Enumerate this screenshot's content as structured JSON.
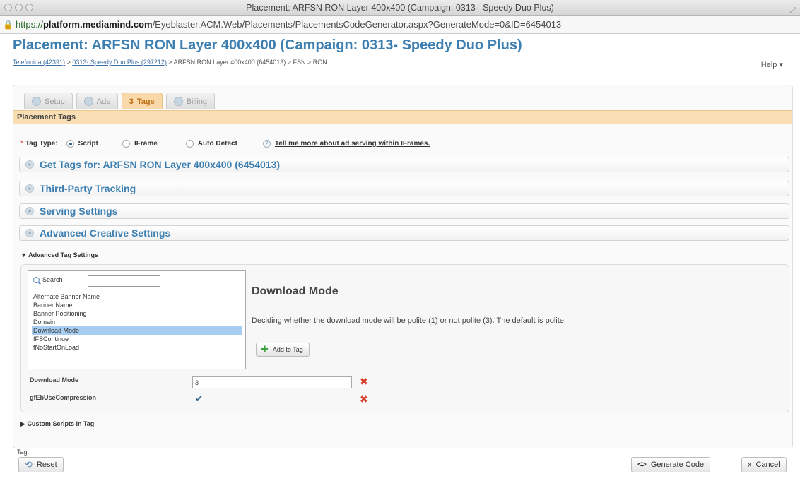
{
  "window": {
    "title": "Placement: ARFSN RON Layer 400x400 (Campaign: 0313– Speedy Duo Plus)"
  },
  "url": {
    "protocol": "https://",
    "host": "platform.mediamind.com",
    "path": "/Eyeblaster.ACM.Web/Placements/PlacementsCodeGenerator.aspx?GenerateMode=0&ID=6454013"
  },
  "header": {
    "title": "Placement: ARFSN RON Layer 400x400 (Campaign: 0313- Speedy Duo Plus)",
    "breadcrumb": {
      "crumb1": "Telefonica (42391)",
      "sep1": " > ",
      "crumb2": "0313- Speedy Duo Plus (297212)",
      "rest": " > ARFSN RON Layer 400x400 (6454013) > FSN > RON"
    },
    "help": "Help"
  },
  "tabs": [
    {
      "label": "Setup",
      "num": ""
    },
    {
      "label": "Ads",
      "num": ""
    },
    {
      "label": "Tags",
      "num": "3"
    },
    {
      "label": "Billing",
      "num": ""
    }
  ],
  "section_title": "Placement Tags",
  "tag_type": {
    "required_mark": "*",
    "label": "Tag Type:",
    "options": [
      "Script",
      "IFrame",
      "Auto Detect"
    ],
    "selected": "Script",
    "help_link": "Tell me more about ad serving within IFrames."
  },
  "accordions": [
    "Get Tags for: ARFSN RON Layer 400x400 (6454013)",
    "Third-Party Tracking",
    "Serving Settings",
    "Advanced Creative Settings"
  ],
  "advanced_tag_settings": {
    "toggle_label": "Advanced Tag Settings",
    "search_label": "Search",
    "search_value": "",
    "options": [
      "Alternate Banner Name",
      "Banner Name",
      "Banner Positioning",
      "Domain",
      "Download Mode",
      "fFSContinue",
      "fNoStartOnLoad"
    ],
    "selected_option": "Download Mode",
    "detail_title": "Download Mode",
    "detail_description": "Deciding whether the download mode will be polite (1) or not polite (3). The default is polite.",
    "add_button": "Add to Tag",
    "params": [
      {
        "name": "Download Mode",
        "value": "3"
      },
      {
        "name": "gfEbUseCompression",
        "value": "",
        "checked": true
      }
    ]
  },
  "custom_scripts_label": "Custom Scripts in Tag",
  "tag_label": "Tag:",
  "footer": {
    "reset": "Reset",
    "generate": "Generate Code",
    "cancel": "Cancel"
  },
  "icons": {
    "checkmark": "✔",
    "delete": "✖"
  }
}
